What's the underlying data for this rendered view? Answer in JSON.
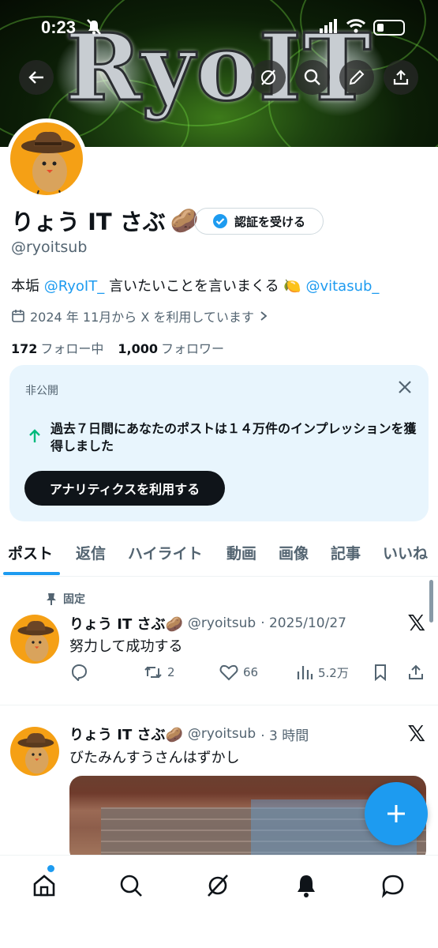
{
  "status_bar": {
    "time": "0:23"
  },
  "banner": {
    "title": "RyoIT"
  },
  "profile": {
    "name": "りょう IT さぶ",
    "name_emoji": "🥔",
    "verify_button": "認証を受ける",
    "handle": "@ryoitsub",
    "bio_prefix": "本垢 ",
    "bio_link1": "@RyoIT_",
    "bio_middle": " 言いたいことを言いまくる 🍋",
    "bio_link2": "@vitasub_",
    "joined": "2024 年 11月から X を利用しています",
    "following_count": "172",
    "following_label": "フォロー中",
    "followers_count": "1,000",
    "followers_label": "フォロワー"
  },
  "private_card": {
    "label": "非公開",
    "message": "過去７日間にあなたのポストは１４万件のインプレッションを獲得しました",
    "button": "アナリティクスを利用する"
  },
  "tabs": [
    "ポスト",
    "返信",
    "ハイライト",
    "動画",
    "画像",
    "記事",
    "いいね"
  ],
  "posts": [
    {
      "pinned_label": "固定",
      "name": "りょう IT さぶ🥔",
      "handle": "@ryoitsub",
      "time": "· 2025/10/27",
      "text": "努力して成功する",
      "reposts": "2",
      "likes": "66",
      "views": "5.2万"
    },
    {
      "name": "りょう IT さぶ🥔",
      "handle": "@ryoitsub",
      "time": "· 3 時間",
      "text": "びたみんすうさんはずかし"
    }
  ],
  "colors": {
    "accent": "#1d9bf0",
    "text": "#0f1419",
    "muted": "#536471",
    "card_bg": "#e8f5fd"
  }
}
